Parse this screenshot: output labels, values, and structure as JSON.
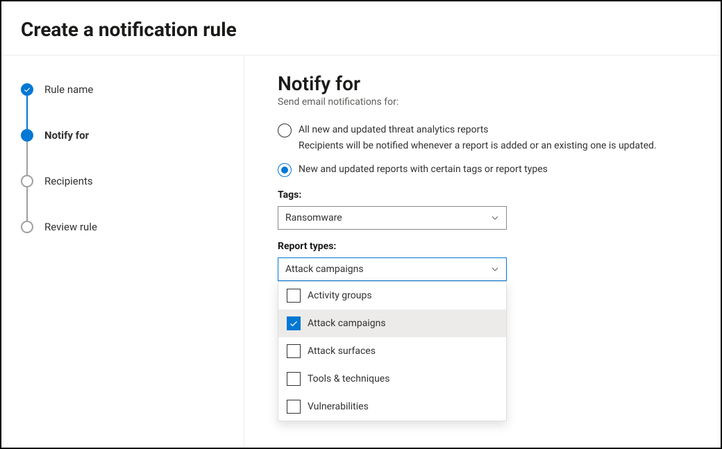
{
  "header": {
    "title": "Create a notification rule"
  },
  "sidebar": {
    "steps": [
      {
        "label": "Rule name",
        "state": "completed"
      },
      {
        "label": "Notify for",
        "state": "current"
      },
      {
        "label": "Recipients",
        "state": "pending"
      },
      {
        "label": "Review rule",
        "state": "pending"
      }
    ]
  },
  "main": {
    "heading": "Notify for",
    "subtitle": "Send email notifications for:",
    "radios": [
      {
        "label": "All new and updated threat analytics reports",
        "sub": "Recipients will be notified whenever a report is added or an existing one is updated.",
        "selected": false
      },
      {
        "label": "New and updated reports with certain tags or report types",
        "sub": "",
        "selected": true
      }
    ],
    "tags": {
      "label": "Tags:",
      "value": "Ransomware"
    },
    "report_types": {
      "label": "Report types:",
      "value": "Attack campaigns",
      "options": [
        {
          "label": "Activity groups",
          "checked": false
        },
        {
          "label": "Attack campaigns",
          "checked": true
        },
        {
          "label": "Attack surfaces",
          "checked": false
        },
        {
          "label": "Tools & techniques",
          "checked": false
        },
        {
          "label": "Vulnerabilities",
          "checked": false
        }
      ]
    }
  }
}
